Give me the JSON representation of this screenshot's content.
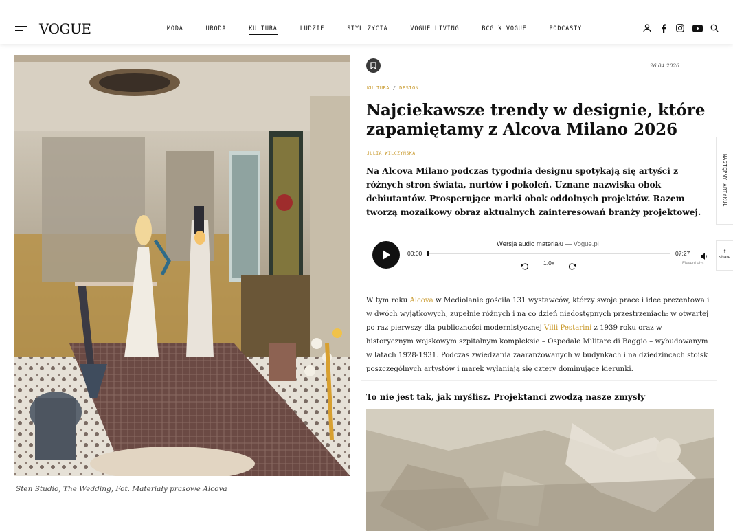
{
  "header": {
    "logo": "VOGUE",
    "nav": [
      "MODA",
      "URODA",
      "KULTURA",
      "LUDZIE",
      "STYL ŻYCIA",
      "VOGUE LIVING",
      "BCG X VOGUE",
      "PODCASTY"
    ],
    "active_nav": "KULTURA",
    "icons": [
      "user-icon",
      "facebook-icon",
      "instagram-icon",
      "youtube-icon",
      "search-icon"
    ]
  },
  "hero": {
    "caption": "Sten Studio, The Wedding, Fot. Materiały prasowe Alcova"
  },
  "article": {
    "date": "26.04.2026",
    "breadcrumb": [
      "KULTURA",
      "DESIGN"
    ],
    "breadcrumb_sep": "/",
    "title": "Najciekawsze trendy w designie, które zapamiętamy z Alcova Milano 2026",
    "author": "JULIA WILCZYŃSKA",
    "lead": "Na Alcova Milano podczas tygodnia designu spotykają się artyści z różnych stron świata, nurtów i pokoleń. Uznane nazwiska obok debiutantów. Prosperujące marki obok oddolnych projektów. Razem tworzą mozaikowy obraz aktualnych zainteresowań branży projektowej.",
    "body_1": "W tym roku ",
    "body_link_1": "Alcova",
    "body_2": " w Mediolanie gościła 131 wystawców, którzy swoje prace i idee prezentowali w dwóch wyjątkowych, zupełnie różnych i na co dzień niedostępnych przestrzeniach: w otwartej po raz pierwszy dla publiczności modernistycznej ",
    "body_link_2": "Villi Pestarini",
    "body_3": " z 1939 roku oraz w historycznym wojskowym szpitalnym kompleksie – Ospedale Militare di Baggio – wybudowanym w latach 1928-1931. Podczas zwiedzania zaaranżowanych w budynkach i na dziedzińcach stoisk poszczególnych artystów i marek wyłaniają się cztery dominujące kierunki.",
    "subhead": "To nie jest tak, jak myślisz. Projektanci zwodzą nasze zmysły"
  },
  "player": {
    "title": "Wersja audio materiału",
    "dash": "—",
    "source": "Vogue.pl",
    "time_current": "00:00",
    "time_total": "07:27",
    "speed": "1.0x",
    "progress": 0,
    "credit": "ElevenLabs"
  },
  "side": {
    "next_label": "NASTĘPNY ARTYKUŁ",
    "share_icon": "f",
    "share_label": "share"
  },
  "colors": {
    "accent": "#c99a2e",
    "text": "#111111"
  }
}
